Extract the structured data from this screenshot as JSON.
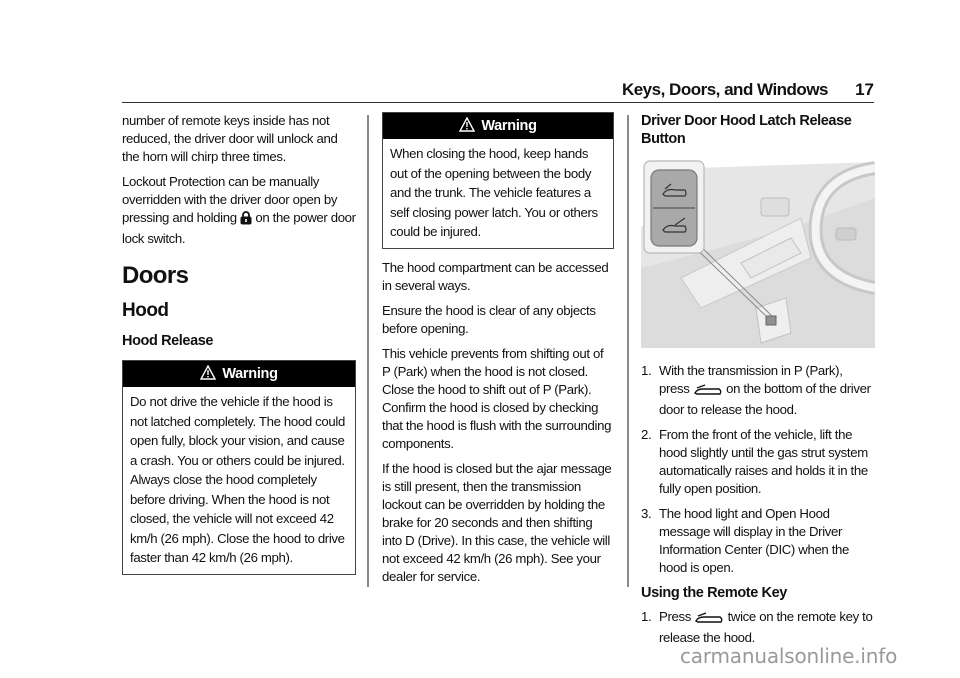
{
  "header": {
    "section_title": "Keys, Doors, and Windows",
    "page_number": "17"
  },
  "col1": {
    "para1": "number of remote keys inside has not reduced, the driver door will unlock and the horn will chirp three times.",
    "para2_before_icon": "Lockout Protection can be manually overridden with the driver door open by pressing and holding ",
    "para2_icon": "lock-icon",
    "para2_after_icon": " on the power door lock switch.",
    "heading_doors": "Doors",
    "heading_hood": "Hood",
    "heading_hood_release": "Hood Release",
    "warning": {
      "label": "Warning",
      "text": "Do not drive the vehicle if the hood is not latched completely. The hood could open fully, block your vision, and cause a crash. You or others could be injured. Always close the hood completely before driving. When the hood is not closed, the vehicle will not exceed 42 km/h (26 mph). Close the hood to drive faster than 42 km/h (26 mph)."
    }
  },
  "col2": {
    "warning": {
      "label": "Warning",
      "text": "When closing the hood, keep hands out of the opening between the body and the trunk. The vehicle features a self closing power latch. You or others could be injured."
    },
    "paragraphs": [
      "The hood compartment can be accessed in several ways.",
      "Ensure the hood is clear of any objects before opening.",
      "This vehicle prevents from shifting out of P (Park) when the hood is not closed. Close the hood to shift out of P (Park). Confirm the hood is closed by checking that the hood is flush with the surrounding components.",
      "If the hood is closed but the ajar message is still present, then the transmission lockout can be overridden by holding the brake for 20 seconds and then shifting into D (Drive). In this case, the vehicle will not exceed 42 km/h (26 mph). See your dealer for service."
    ]
  },
  "col3": {
    "heading_latch": "Driver Door Hood Latch Release Button",
    "figure_alt": "Driver door hood latch release button illustration",
    "steps": [
      {
        "num": "1.",
        "before": "With the transmission in P (Park), press ",
        "icon": "hood-release-icon",
        "after": " on the bottom of the driver door to release the hood."
      },
      {
        "num": "2.",
        "text": "From the front of the vehicle, lift the hood slightly until the gas strut system automatically raises and holds it in the fully open position."
      },
      {
        "num": "3.",
        "text": "The hood light and Open Hood message will display in the Driver Information Center (DIC) when the hood is open."
      }
    ],
    "heading_remote": "Using the Remote Key",
    "remote_steps": [
      {
        "num": "1.",
        "before": "Press ",
        "icon": "hood-release-icon",
        "after": " twice on the remote key to release the hood."
      }
    ]
  },
  "watermark": "carmanualsonline.info"
}
